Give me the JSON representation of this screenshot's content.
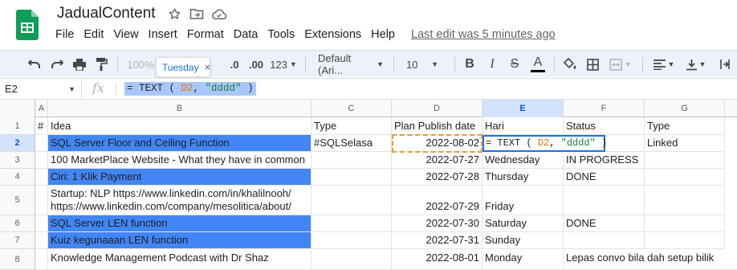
{
  "app": {
    "doc_title": "JadualContent",
    "title_icons": [
      "star-icon",
      "move-to-folder-icon",
      "cloud-status-icon"
    ],
    "menu": [
      "File",
      "Edit",
      "View",
      "Insert",
      "Format",
      "Data",
      "Tools",
      "Extensions",
      "Help"
    ],
    "last_edit": "Last edit was 5 minutes ago"
  },
  "toolbar": {
    "zoom": "100%",
    "decimal_decrease": ".0",
    "decimal_increase": ".00",
    "number_format": "123",
    "font": "Default (Ari...",
    "font_size": "10",
    "bold": "B",
    "italic": "I",
    "strikethrough": "S",
    "text_color": "A",
    "text_color_bar": "#000000",
    "tooltip": "Tuesday",
    "tooltip_close": "×"
  },
  "formula_bar": {
    "name_box": "E2",
    "fx": "fx",
    "formula_prefix": "= TEXT ( ",
    "formula_ref": "D2",
    "formula_sep": ", ",
    "formula_str": "\"dddd\"",
    "formula_suffix": " )"
  },
  "grid": {
    "selected_col": "E",
    "selected_row": "2",
    "columns": [
      "A",
      "B",
      "C",
      "D",
      "E",
      "F",
      "G"
    ],
    "row_numbers": [
      "1",
      "2",
      "3",
      "4",
      "5",
      "6",
      "7",
      "8"
    ],
    "headers": {
      "a": "#",
      "b": "Idea",
      "c": "Type",
      "d": "Plan Publish date",
      "e": "Hari",
      "f": "Status",
      "g": "Type"
    },
    "rows": [
      {
        "b": "SQL Server Floor and  Ceiling Function",
        "c": "#SQLSelasa",
        "d": "2022-08-02",
        "e": "= TEXT ( D2, \"dddd\" )",
        "f": "",
        "g": "Linked",
        "highlight": true
      },
      {
        "b": "100 MarketPlace Website - What they have in common",
        "c": "",
        "d": "2022-07-27",
        "e": "Wednesday",
        "f": "IN PROGRESS",
        "g": "",
        "highlight": false
      },
      {
        "b": "Ciri:  1 Klik Payment",
        "c": "",
        "d": "2022-07-28",
        "e": "Thursday",
        "f": "DONE",
        "g": "",
        "highlight": true
      },
      {
        "b": "Startup: NLP https://www.linkedin.com/in/khalilnooh/",
        "b2": "https://www.linkedin.com/company/mesolitica/about/",
        "c": "",
        "d": "2022-07-29",
        "e": "Friday",
        "f": "",
        "g": "",
        "highlight": false
      },
      {
        "b": "SQL Server LEN function",
        "c": "",
        "d": "2022-07-30",
        "e": "Saturday",
        "f": "DONE",
        "g": "",
        "highlight": true
      },
      {
        "b": "Kuiz kegunaaan  LEN function",
        "c": "",
        "d": "2022-07-31",
        "e": "Sunday",
        "f": "",
        "g": "",
        "highlight": true
      },
      {
        "b": "Knowledge Management  Podcast with Dr Shaz",
        "c": "",
        "d": "2022-08-01",
        "e": "Monday",
        "f": "Lepas convo bila dah setup bilik",
        "g": "",
        "highlight": false
      }
    ],
    "editor": {
      "prefix": "= TEXT ( ",
      "ref": "D2",
      "sep": ", ",
      "str": "\"dddd\"",
      "suffix": " )"
    },
    "colors": {
      "highlight": "#4285f4",
      "selection": "#1a73e8",
      "copy_border": "#f09c33",
      "ref": "#e37400",
      "string": "#188038"
    }
  }
}
